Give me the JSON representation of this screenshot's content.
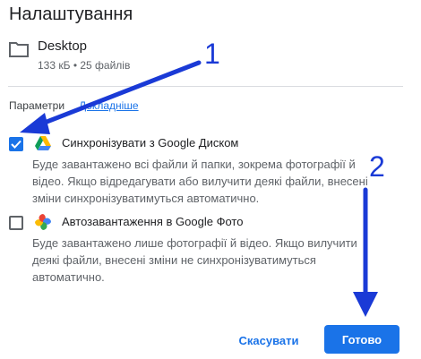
{
  "dialog": {
    "title": "Налаштування",
    "folder": {
      "name": "Desktop",
      "meta": "133 кБ • 25 файлів",
      "icon": "folder-icon"
    },
    "params_label": "Параметри",
    "details_link": "Докладніше",
    "options": [
      {
        "title": "Синхронізувати з Google Диском",
        "checked": true,
        "icon": "google-drive-icon",
        "desc_lines": [
          "Буде завантажено всі файли й папки, зокрема фотографії й",
          "відео. Якщо відредагувати або вилучити деякі файли, внесені",
          "зміни синхронізуватимуться автоматично."
        ]
      },
      {
        "title": "Автозавантаження в Google Фото",
        "checked": false,
        "icon": "google-photos-icon",
        "desc_lines": [
          "Буде завантажено лише фотографії й відео. Якщо вилучити",
          "деякі файли, внесені зміни не синхронізуватимуться",
          "автоматично."
        ]
      }
    ],
    "cancel_label": "Скасувати",
    "ok_label": "Готово"
  },
  "annotations": {
    "step1": "1",
    "step2": "2",
    "arrow_color": "#1a3ad6"
  },
  "colors": {
    "accent": "#1a73e8",
    "text": "#202124",
    "muted": "#5f6368"
  }
}
